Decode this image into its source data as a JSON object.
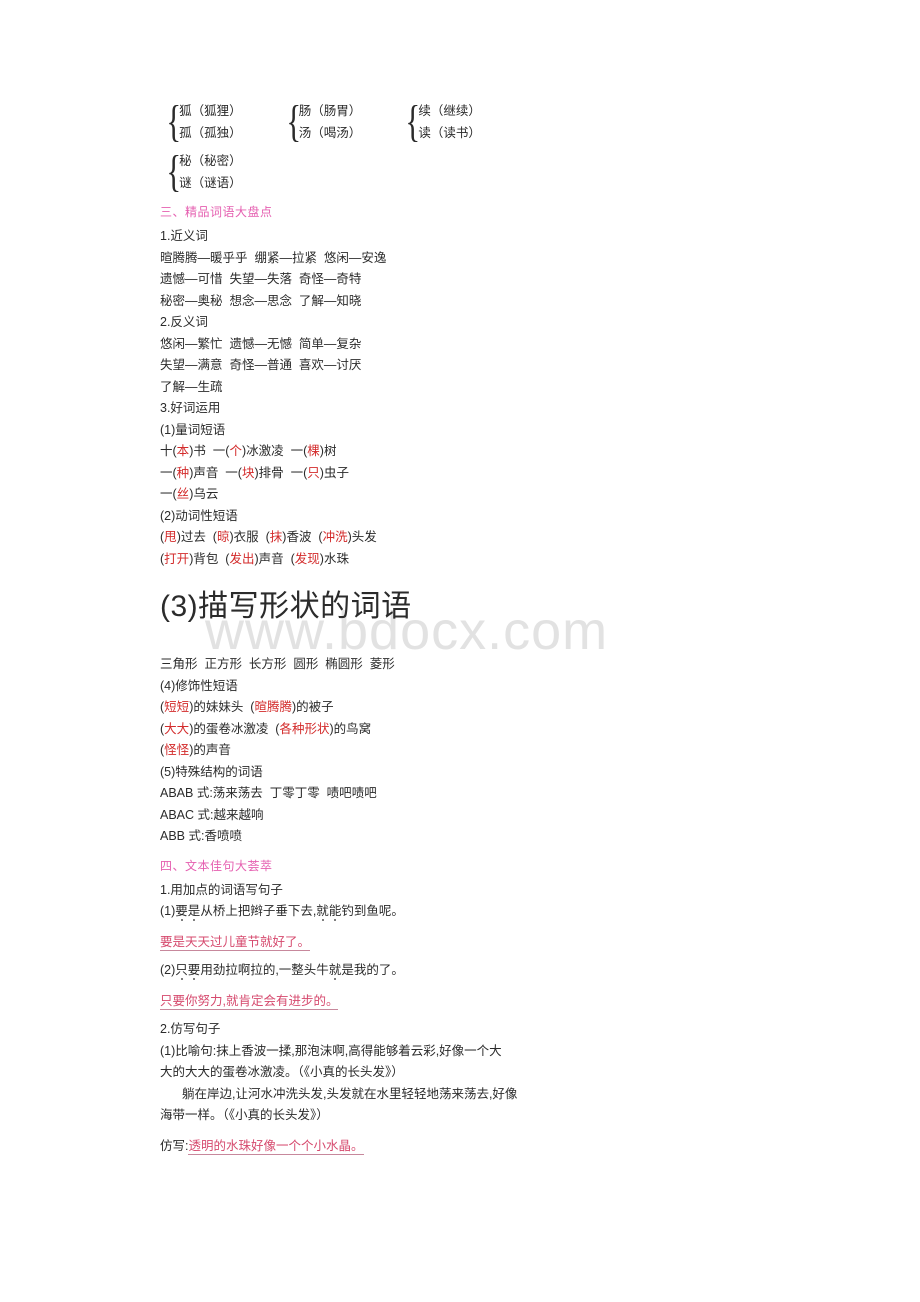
{
  "watermark": "www.bdocx.com",
  "brace_groups": [
    [
      {
        "top": "狐（狐狸）",
        "bottom": "孤（孤独）"
      },
      {
        "top": "肠（肠胃）",
        "bottom": "汤（喝汤）"
      },
      {
        "top": "续（继续）",
        "bottom": "读（读书）"
      }
    ],
    [
      {
        "top": "秘（秘密）",
        "bottom": "谜（谜语）"
      }
    ]
  ],
  "section3": {
    "heading": "三、精品词语大盘点",
    "sub1": {
      "label": "1.近义词",
      "lines": [
        "暄腾腾—暖乎乎  绷紧—拉紧  悠闲—安逸",
        "遗憾—可惜  失望—失落  奇怪—奇特",
        "秘密—奥秘  想念—思念  了解—知晓"
      ]
    },
    "sub2": {
      "label": "2.反义词",
      "lines": [
        "悠闲—繁忙  遗憾—无憾  简单—复杂",
        "失望—满意  奇怪—普通  喜欢—讨厌",
        "了解—生疏"
      ]
    },
    "sub3": {
      "label": "3.好词运用",
      "part1_label": "(1)量词短语",
      "part1_lines": [
        [
          {
            "t": "十("
          },
          {
            "t": "本",
            "c": "red"
          },
          {
            "t": ")书  一("
          },
          {
            "t": "个",
            "c": "red"
          },
          {
            "t": ")冰激凌  一("
          },
          {
            "t": "棵",
            "c": "red"
          },
          {
            "t": ")树"
          }
        ],
        [
          {
            "t": "一("
          },
          {
            "t": "种",
            "c": "red"
          },
          {
            "t": ")声音  一("
          },
          {
            "t": "块",
            "c": "red"
          },
          {
            "t": ")排骨  一("
          },
          {
            "t": "只",
            "c": "red"
          },
          {
            "t": ")虫子"
          }
        ],
        [
          {
            "t": "一("
          },
          {
            "t": "丝",
            "c": "red"
          },
          {
            "t": ")乌云"
          }
        ]
      ],
      "part2_label": "(2)动词性短语",
      "part2_lines": [
        [
          {
            "t": "("
          },
          {
            "t": "甩",
            "c": "red"
          },
          {
            "t": ")过去  ("
          },
          {
            "t": "晾",
            "c": "red"
          },
          {
            "t": ")衣服  ("
          },
          {
            "t": "抹",
            "c": "red"
          },
          {
            "t": ")香波  ("
          },
          {
            "t": "冲洗",
            "c": "red"
          },
          {
            "t": ")头发"
          }
        ],
        [
          {
            "t": "("
          },
          {
            "t": "打开",
            "c": "red"
          },
          {
            "t": ")背包  ("
          },
          {
            "t": "发出",
            "c": "red"
          },
          {
            "t": ")声音  ("
          },
          {
            "t": "发现",
            "c": "red"
          },
          {
            "t": ")水珠"
          }
        ]
      ],
      "part3_label": "(3)描写形状的词语",
      "part3_line": "三角形  正方形  长方形  圆形  椭圆形  菱形",
      "part4_label": "(4)修饰性短语",
      "part4_lines": [
        [
          {
            "t": "("
          },
          {
            "t": "短短",
            "c": "red"
          },
          {
            "t": ")的妹妹头  ("
          },
          {
            "t": "暄腾腾",
            "c": "red"
          },
          {
            "t": ")的被子"
          }
        ],
        [
          {
            "t": "("
          },
          {
            "t": "大大",
            "c": "red"
          },
          {
            "t": ")的蛋卷冰激凌  ("
          },
          {
            "t": "各种形状",
            "c": "red"
          },
          {
            "t": ")的鸟窝"
          }
        ],
        [
          {
            "t": "("
          },
          {
            "t": "怪怪",
            "c": "red"
          },
          {
            "t": ")的声音"
          }
        ]
      ],
      "part5_label": "(5)特殊结构的词语",
      "part5_lines": [
        "ABAB 式:荡来荡去  丁零丁零  啧吧啧吧",
        "ABAC 式:越来越响",
        "ABB 式:香喷喷"
      ]
    }
  },
  "section4": {
    "heading": "四、文本佳句大荟萃",
    "sub1_label": "1.用加点的词语写句子",
    "q1": {
      "prefix": "(1)",
      "parts": [
        {
          "t": "要是",
          "dot": true
        },
        {
          "t": "从桥上把辫子垂下去,"
        },
        {
          "t": "就能",
          "dot": true
        },
        {
          "t": "钓到鱼呢。"
        }
      ],
      "answer": "要是天天过儿童节就好了。"
    },
    "q2": {
      "prefix": "(2)",
      "parts": [
        {
          "t": "只要",
          "dot": true
        },
        {
          "t": "用劲拉啊拉的,一整头牛"
        },
        {
          "t": "就",
          "dot": true
        },
        {
          "t": "是我的了。"
        }
      ],
      "answer": "只要你努力,就肯定会有进步的。"
    },
    "sub2_label": "2.仿写句子",
    "example1_line1": "(1)比喻句:抹上香波一揉,那泡沫啊,高得能够着云彩,好像一个大",
    "example1_line2": "大的大大的蛋卷冰激凌。（《小真的长头发》）",
    "example2_line1": "躺在岸边,让河水冲洗头发,头发就在水里轻轻地荡来荡去,好像",
    "example2_line2": "海带一样。（《小真的长头发》）",
    "imitate_label": "仿写:",
    "imitate_answer": "透明的水珠好像一个个小水晶。"
  }
}
